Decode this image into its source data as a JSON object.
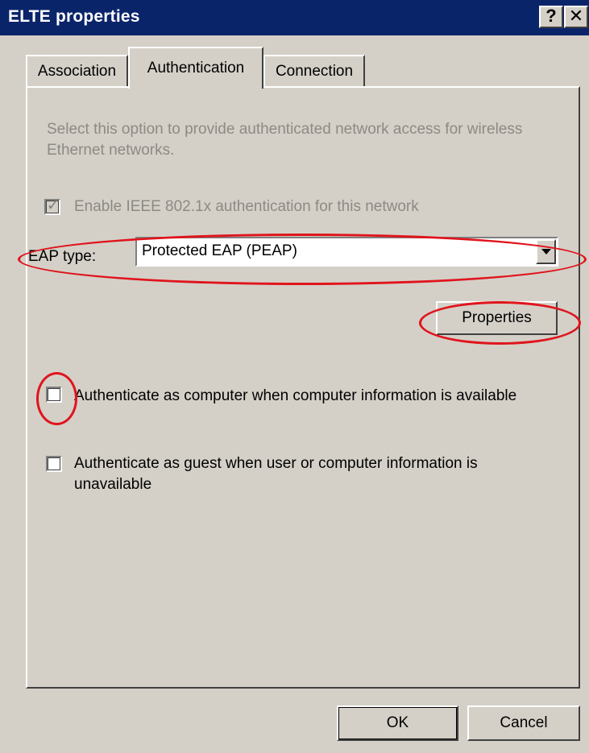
{
  "window": {
    "title": "ELTE properties",
    "help_button": "?",
    "close_button": "✕"
  },
  "tabs": [
    {
      "label": "Association",
      "selected": false
    },
    {
      "label": "Authentication",
      "selected": true
    },
    {
      "label": "Connection",
      "selected": false
    }
  ],
  "authentication": {
    "description": "Select this option to provide authenticated network access for wireless Ethernet networks.",
    "enable_8021x": {
      "label": "Enable IEEE 802.1x authentication for this network",
      "checked": true,
      "disabled": true
    },
    "eap_type_label": "EAP type:",
    "eap_type_value": "Protected EAP (PEAP)",
    "properties_button": "Properties",
    "auth_as_computer": {
      "label": "Authenticate as computer when computer information is available",
      "checked": false
    },
    "auth_as_guest": {
      "label": "Authenticate as guest when user or computer information is unavailable",
      "checked": false
    }
  },
  "footer": {
    "ok_label": "OK",
    "cancel_label": "Cancel"
  },
  "annotation_color": "#e0141c"
}
